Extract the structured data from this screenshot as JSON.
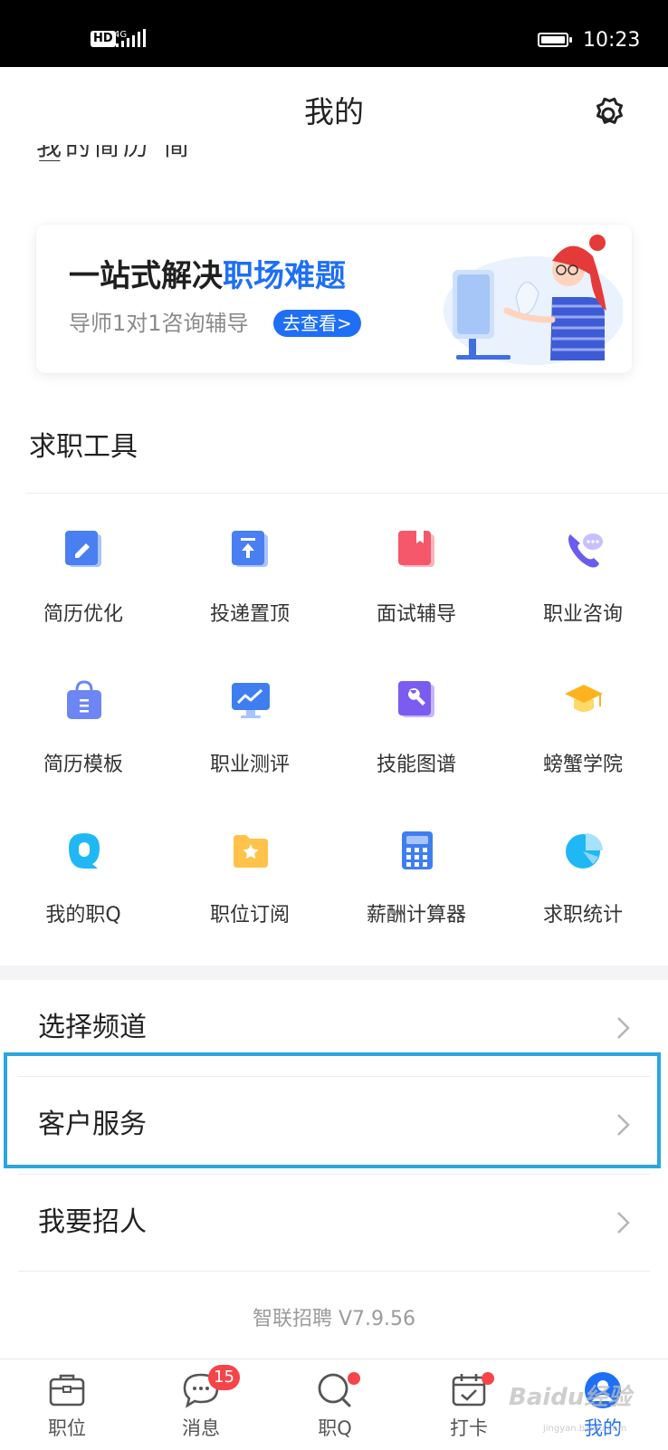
{
  "status_bar": {
    "network": "4G",
    "hd": "HD",
    "time": "10:23"
  },
  "header": {
    "title": "我的",
    "cut_text": "我的简历 简历"
  },
  "banner": {
    "title_plain": "一站式解决",
    "title_highlight": "职场难题",
    "subtitle": "导师1对1咨询辅导",
    "button_label": "去查看>"
  },
  "tools": {
    "title": "求职工具",
    "items": [
      {
        "label": "简历优化",
        "icon": "pencil-doc-icon"
      },
      {
        "label": "投递置顶",
        "icon": "upload-top-icon"
      },
      {
        "label": "面试辅导",
        "icon": "bookmark-book-icon"
      },
      {
        "label": "职业咨询",
        "icon": "phone-chat-icon"
      },
      {
        "label": "简历模板",
        "icon": "bag-icon"
      },
      {
        "label": "职业测评",
        "icon": "monitor-chart-icon"
      },
      {
        "label": "技能图谱",
        "icon": "wrench-icon"
      },
      {
        "label": "螃蟹学院",
        "icon": "graduation-cap-icon"
      },
      {
        "label": "我的职Q",
        "icon": "q-bubble-icon"
      },
      {
        "label": "职位订阅",
        "icon": "folder-star-icon"
      },
      {
        "label": "薪酬计算器",
        "icon": "calculator-icon"
      },
      {
        "label": "求职统计",
        "icon": "pie-chart-icon"
      }
    ]
  },
  "menu": [
    {
      "label": "选择频道"
    },
    {
      "label": "客户服务"
    },
    {
      "label": "我要招人"
    }
  ],
  "version": "智联招聘 V7.9.56",
  "tab_bar": {
    "tabs": [
      {
        "label": "职位",
        "icon": "briefcase-icon"
      },
      {
        "label": "消息",
        "icon": "chat-bubble-icon",
        "badge": "15"
      },
      {
        "label": "职Q",
        "icon": "q-search-icon"
      },
      {
        "label": "打卡",
        "icon": "calendar-check-icon"
      },
      {
        "label": "我的",
        "icon": "user-avatar-icon"
      }
    ]
  },
  "watermark": {
    "main": "Baidu经验",
    "sub": "jingyan.baidu.com"
  },
  "colors": {
    "accent": "#1e6ff5",
    "badge": "#f5444a",
    "highlight": "#2ba6df"
  }
}
